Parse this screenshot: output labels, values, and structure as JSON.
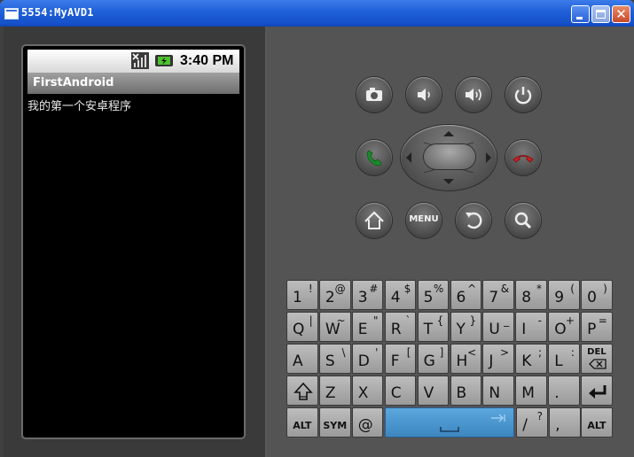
{
  "window": {
    "title": "5554:MyAVD1",
    "close_glyph": "✕"
  },
  "phone": {
    "status": {
      "time": "3:40 PM"
    },
    "app": {
      "title": "FirstAndroid"
    },
    "content": {
      "message": "我的第一个安卓程序"
    }
  },
  "controls": {
    "row1": [
      {
        "name": "camera-icon"
      },
      {
        "name": "volume-down-icon"
      },
      {
        "name": "volume-up-icon"
      },
      {
        "name": "power-icon"
      }
    ],
    "call_icon": "call-icon",
    "end_call_icon": "end-call-icon",
    "menu_label": "MENU",
    "row3": [
      {
        "name": "home-icon"
      },
      {
        "name": "menu-button"
      },
      {
        "name": "back-icon"
      },
      {
        "name": "search-icon"
      }
    ]
  },
  "keyboard": {
    "row1": [
      {
        "m": "1",
        "a": "!"
      },
      {
        "m": "2",
        "a": "@"
      },
      {
        "m": "3",
        "a": "#"
      },
      {
        "m": "4",
        "a": "$"
      },
      {
        "m": "5",
        "a": "%"
      },
      {
        "m": "6",
        "a": "^"
      },
      {
        "m": "7",
        "a": "&"
      },
      {
        "m": "8",
        "a": "*"
      },
      {
        "m": "9",
        "a": "("
      },
      {
        "m": "0",
        "a": ")"
      }
    ],
    "row2": [
      {
        "m": "Q",
        "a": "|"
      },
      {
        "m": "W",
        "a": "~"
      },
      {
        "m": "E",
        "a": "\""
      },
      {
        "m": "R",
        "a": "`"
      },
      {
        "m": "T",
        "a": "{"
      },
      {
        "m": "Y",
        "a": "}"
      },
      {
        "m": "U",
        "a": "_"
      },
      {
        "m": "I",
        "a": "-"
      },
      {
        "m": "O",
        "a": "+"
      },
      {
        "m": "P",
        "a": "="
      }
    ],
    "row3": [
      {
        "m": "A",
        "a": ""
      },
      {
        "m": "S",
        "a": "\\"
      },
      {
        "m": "D",
        "a": "'"
      },
      {
        "m": "F",
        "a": "["
      },
      {
        "m": "G",
        "a": "]"
      },
      {
        "m": "H",
        "a": "<"
      },
      {
        "m": "J",
        "a": ">"
      },
      {
        "m": "K",
        "a": ";"
      },
      {
        "m": "L",
        "a": ":"
      }
    ],
    "del_label": "DEL",
    "row4": [
      {
        "m": "Z",
        "a": ""
      },
      {
        "m": "X",
        "a": ""
      },
      {
        "m": "C",
        "a": ""
      },
      {
        "m": "V",
        "a": ""
      },
      {
        "m": "B",
        "a": ""
      },
      {
        "m": "N",
        "a": ""
      },
      {
        "m": "M",
        "a": ""
      },
      {
        "m": ".",
        "a": ""
      }
    ],
    "alt_label": "ALT",
    "sym_label": "SYM",
    "at_key": "@",
    "slash_key": {
      "m": "/",
      "a": "?"
    },
    "comma_key": ","
  },
  "colors": {
    "titlebar": "#1f5fd8",
    "space_key": "#4a97d0",
    "call_green": "#1b8a2a",
    "end_red": "#c62020"
  }
}
